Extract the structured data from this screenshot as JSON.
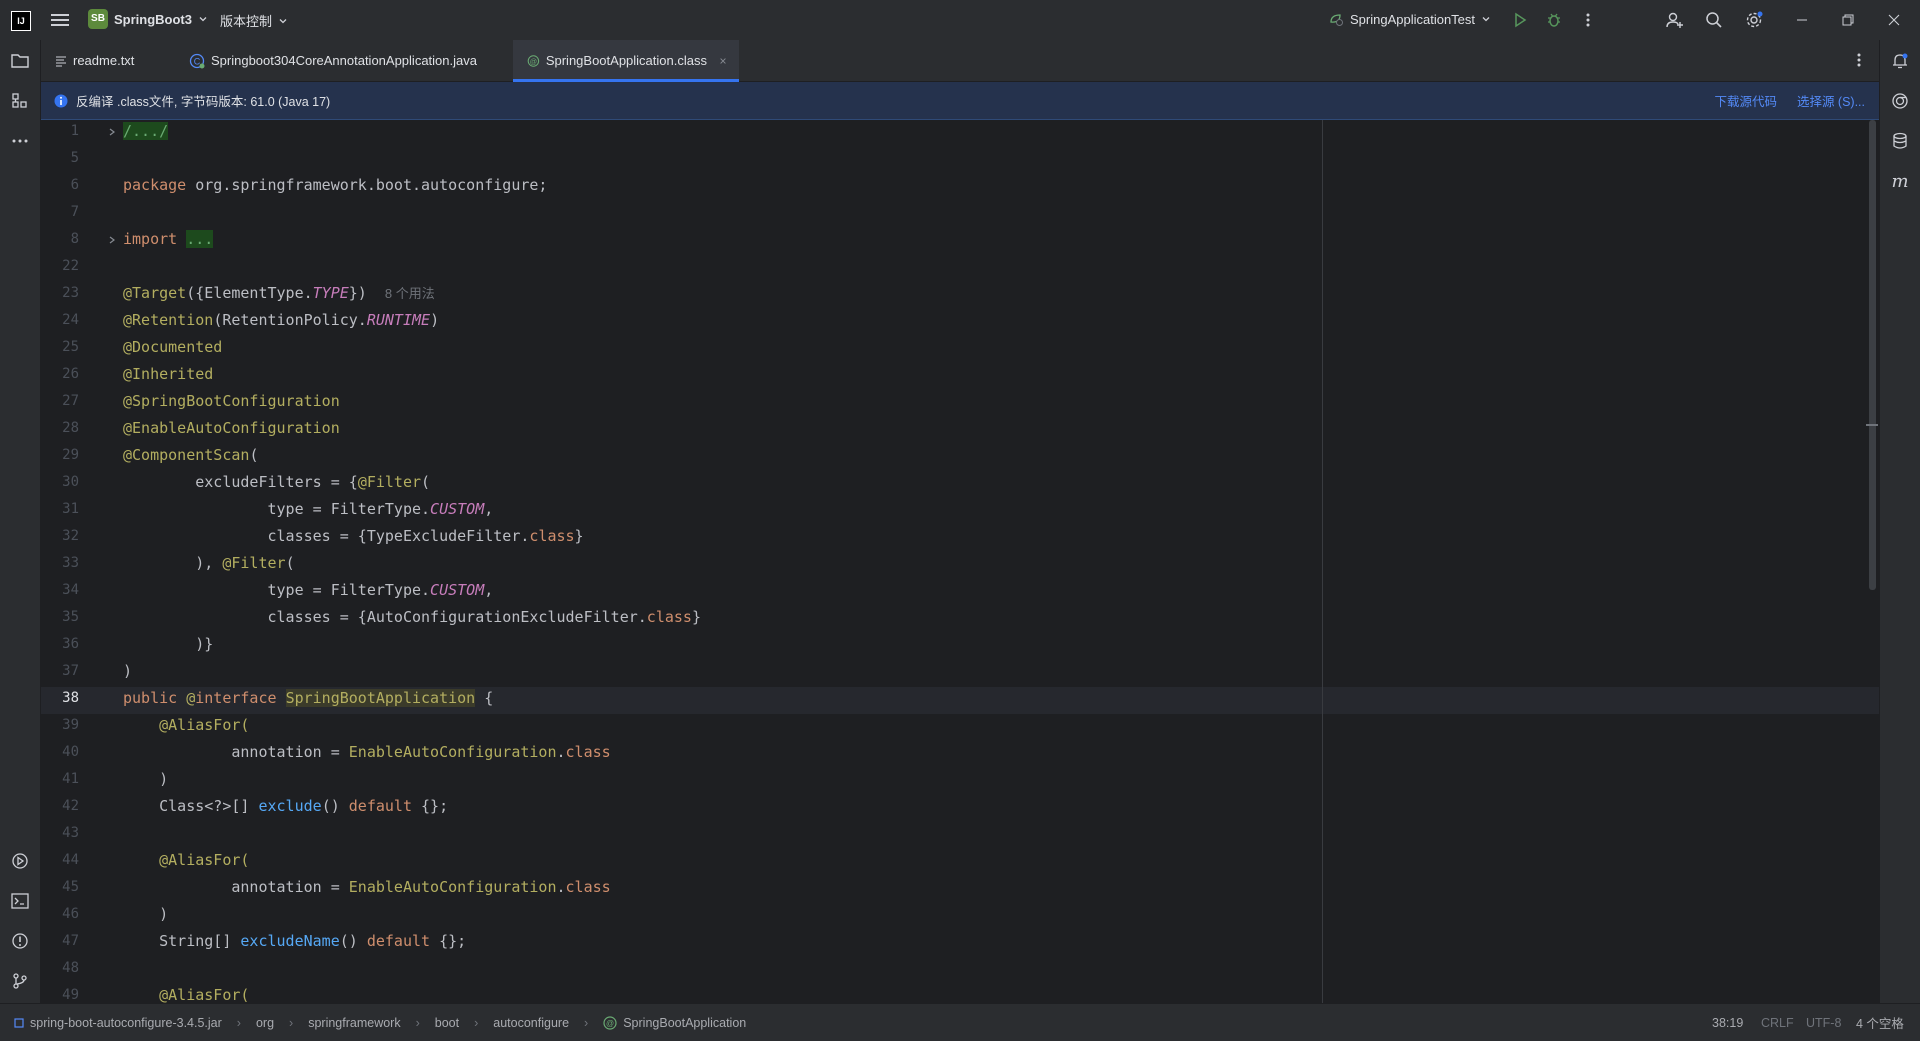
{
  "titlebar": {
    "project_badge": "SB",
    "project_name": "SpringBoot3",
    "vcs_menu": "版本控制",
    "run_config": "SpringApplicationTest"
  },
  "tabs": [
    {
      "label": "readme.txt",
      "icon": "text-file-icon"
    },
    {
      "label": "Springboot304CoreAnnotationApplication.java",
      "icon": "java-class-icon"
    },
    {
      "label": "SpringBootApplication.class",
      "icon": "annotation-class-icon",
      "active": true
    }
  ],
  "banner": {
    "message": "反编译 .class文件, 字节码版本: 61.0 (Java 17)",
    "download_link": "下载源代码",
    "choose_source_link": "选择源 (S)..."
  },
  "editor": {
    "usage_hint": "8 个用法",
    "lines": [
      {
        "n": "1"
      },
      {
        "n": "5"
      },
      {
        "n": "6"
      },
      {
        "n": "7"
      },
      {
        "n": "8"
      },
      {
        "n": "22"
      },
      {
        "n": "23"
      },
      {
        "n": "24"
      },
      {
        "n": "25"
      },
      {
        "n": "26"
      },
      {
        "n": "27"
      },
      {
        "n": "28"
      },
      {
        "n": "29"
      },
      {
        "n": "30"
      },
      {
        "n": "31"
      },
      {
        "n": "32"
      },
      {
        "n": "33"
      },
      {
        "n": "34"
      },
      {
        "n": "35"
      },
      {
        "n": "36"
      },
      {
        "n": "37"
      },
      {
        "n": "38"
      },
      {
        "n": "39"
      },
      {
        "n": "40"
      },
      {
        "n": "41"
      },
      {
        "n": "42"
      },
      {
        "n": "43"
      },
      {
        "n": "44"
      },
      {
        "n": "45"
      },
      {
        "n": "46"
      },
      {
        "n": "47"
      },
      {
        "n": "48"
      },
      {
        "n": "49"
      }
    ],
    "code": {
      "l1": "/.../",
      "l6a": "package",
      "l6b": " org.springframework.boot.autoconfigure;",
      "l8a": "import",
      "l8b": "...",
      "l23a": "@Target",
      "l23b": "({ElementType.",
      "l23c": "TYPE",
      "l23d": "})",
      "l24a": "@Retention",
      "l24b": "(RetentionPolicy.",
      "l24c": "RUNTIME",
      "l24d": ")",
      "l25": "@Documented",
      "l26": "@Inherited",
      "l27": "@SpringBootConfiguration",
      "l28": "@EnableAutoConfiguration",
      "l29a": "@ComponentScan",
      "l29b": "(",
      "l30a": "        excludeFilters = {",
      "l30b": "@Filter",
      "l30c": "(",
      "l31a": "                type = FilterType.",
      "l31b": "CUSTOM",
      "l31c": ",",
      "l32a": "                classes = {TypeExcludeFilter.",
      "l32b": "class",
      "l32c": "}",
      "l33a": "        ), ",
      "l33b": "@Filter",
      "l33c": "(",
      "l34a": "                type = FilterType.",
      "l34b": "CUSTOM",
      "l34c": ",",
      "l35a": "                classes = {AutoConfigurationExcludeFilter.",
      "l35b": "class",
      "l35c": "}",
      "l36": "        )}",
      "l37": ")",
      "l38a": "public",
      "l38b": " @",
      "l38c": "interface",
      "l38d": " ",
      "l38e": "SpringBootApplication",
      "l38f": " {",
      "l39": "    @AliasFor(",
      "l40a": "            annotation = ",
      "l40b": "EnableAutoConfiguration",
      "l40c": ".",
      "l40d": "class",
      "l41": "    )",
      "l42a": "    Class<?>[] ",
      "l42b": "exclude",
      "l42c": "() ",
      "l42d": "default",
      "l42e": " {};",
      "l44": "    @AliasFor(",
      "l45a": "            annotation = ",
      "l45b": "EnableAutoConfiguration",
      "l45c": ".",
      "l45d": "class",
      "l46": "    )",
      "l47a": "    String[] ",
      "l47b": "excludeName",
      "l47c": "() ",
      "l47d": "default",
      "l47e": " {};",
      "l49": "    @AliasFor("
    }
  },
  "statusbar": {
    "breadcrumbs": [
      "spring-boot-autoconfigure-3.4.5.jar",
      "org",
      "springframework",
      "boot",
      "autoconfigure",
      "SpringBootApplication"
    ],
    "position": "38:19",
    "line_ending": "CRLF",
    "encoding": "UTF-8",
    "indent": "4 个空格"
  },
  "colors": {
    "accent": "#3574f0",
    "background": "#1e1f22",
    "panel": "#2b2d30",
    "keyword": "#cf8e6d",
    "annotation": "#b3ae60",
    "constant": "#c77dbb",
    "method": "#56a8f5"
  }
}
